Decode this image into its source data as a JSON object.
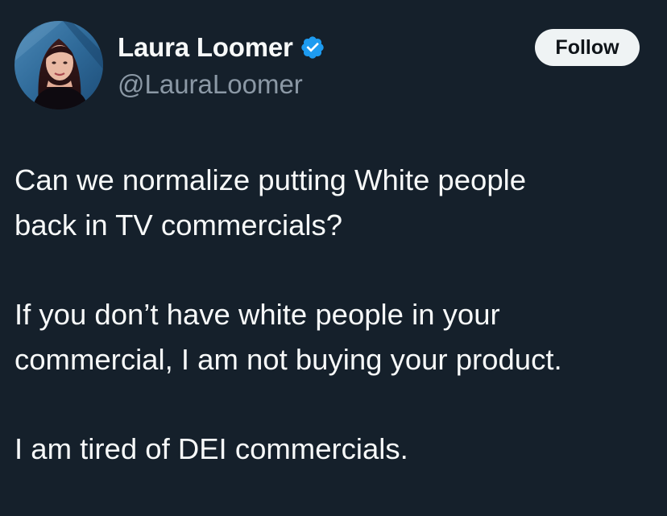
{
  "author": {
    "display_name": "Laura Loomer",
    "handle": "@LauraLoomer",
    "verified": true,
    "avatar_icon": "profile-photo"
  },
  "follow_button": {
    "label": "Follow"
  },
  "tweet": {
    "paragraphs": [
      {
        "lines": [
          "Can we normalize putting White people",
          "back in TV commercials?"
        ]
      },
      {
        "lines": [
          "If you don’t have white people in your",
          "commercial, I am not buying your product."
        ]
      },
      {
        "lines": [
          "I am tired of DEI commercials."
        ]
      }
    ]
  },
  "colors": {
    "background": "#15202b",
    "text_primary": "#f7f9f9",
    "text_secondary": "#8b98a5",
    "verified_badge": "#1d9bf0",
    "follow_button_bg": "#eff3f4"
  }
}
